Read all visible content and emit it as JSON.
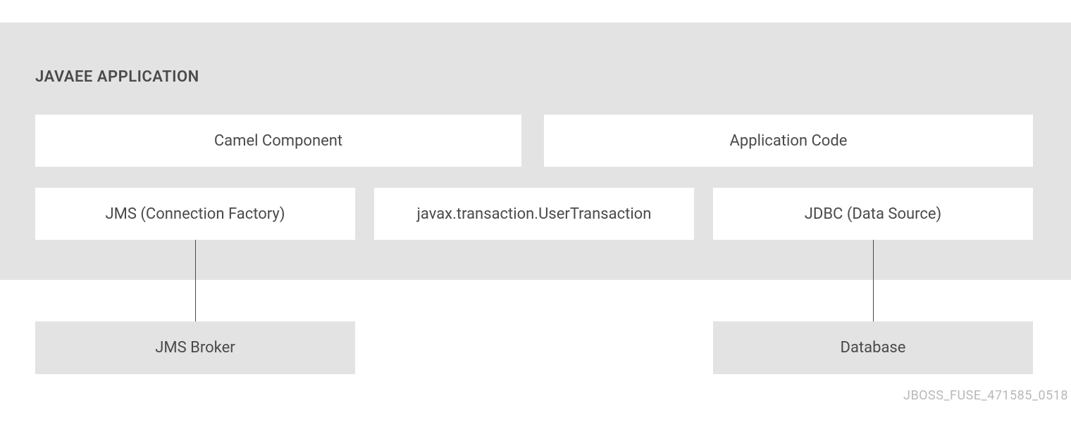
{
  "title": "JAVAEE APPLICATION",
  "boxes": {
    "camel": "Camel Component",
    "appcode": "Application Code",
    "jms_cf": "JMS (Connection Factory)",
    "usertx": "javax.transaction.UserTransaction",
    "jdbc": "JDBC (Data Source)",
    "broker": "JMS Broker",
    "database": "Database"
  },
  "footer": "JBOSS_FUSE_471585_0518"
}
